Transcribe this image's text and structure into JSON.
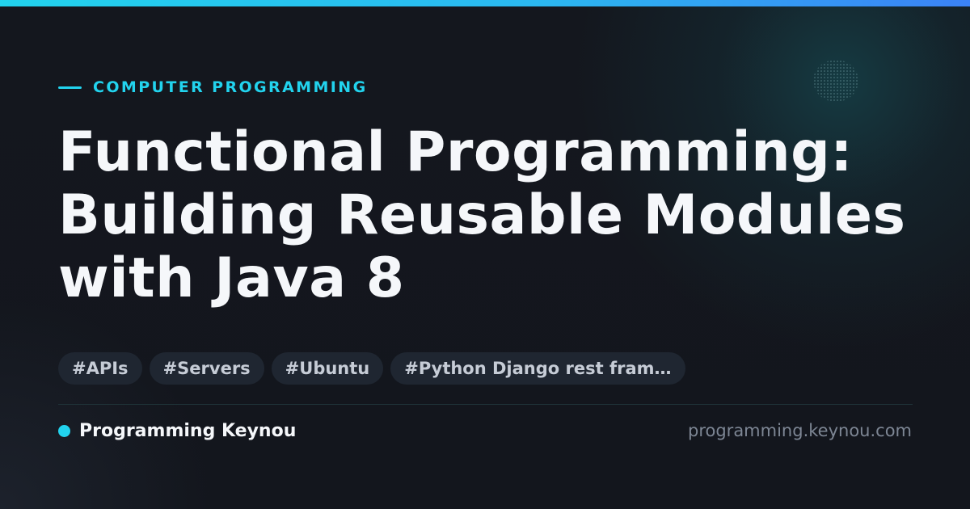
{
  "card": {
    "category": "COMPUTER PROGRAMMING",
    "title_lines": [
      "Functional Programming:",
      "Building Reusable Modules",
      "with Java 8"
    ],
    "tags": [
      "#APIs",
      "#Servers",
      "#Ubuntu",
      "#Python Django rest fram…"
    ],
    "author": "Programming Keynou",
    "site_url": "programming.keynou.com"
  },
  "colors": {
    "accent": "#22d3ee",
    "accent_end": "#3b82f6",
    "background": "#13161d",
    "title_text": "#f5f7fa",
    "tag_background": "#1f2631",
    "tag_text": "#c6ccd6",
    "muted_text": "#7d8694"
  },
  "icons": {
    "category_marker": "dash-line-icon",
    "author_marker": "dot-icon"
  }
}
